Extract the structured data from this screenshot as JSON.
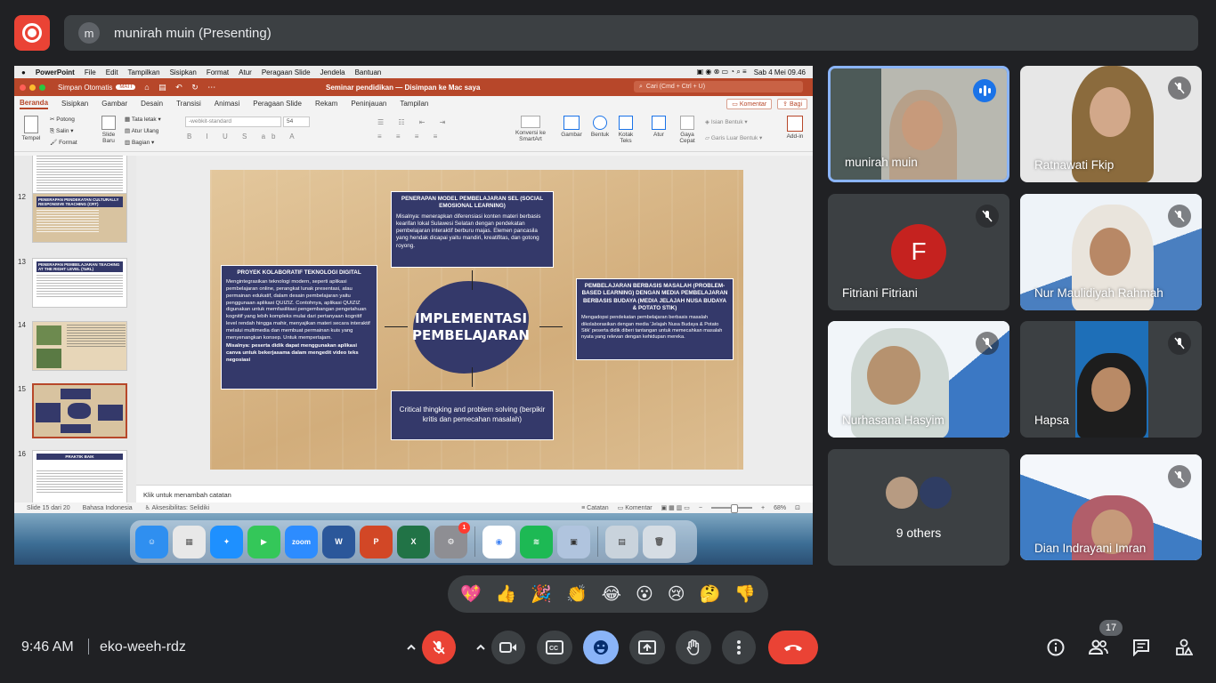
{
  "presenter_bar": {
    "avatar_initial": "m",
    "label": "munirah muin (Presenting)"
  },
  "mac_menu": {
    "items": [
      "PowerPoint",
      "File",
      "Edit",
      "Tampilkan",
      "Sisipkan",
      "Format",
      "Atur",
      "Peragaan Slide",
      "Jendela",
      "Bantuan"
    ],
    "datetime": "Sab 4 Mei  09.46"
  },
  "ppt_titlebar": {
    "autosave": "Simpan Otomatis",
    "autosave_state": "MATI",
    "doc_title": "Seminar pendidikan — Disimpan ke Mac saya",
    "search_placeholder": "Cari (Cmd + Ctrl + U)"
  },
  "ribbon_tabs": [
    "Beranda",
    "Sisipkan",
    "Gambar",
    "Desain",
    "Transisi",
    "Animasi",
    "Peragaan Slide",
    "Rekam",
    "Peninjauan",
    "Tampilan"
  ],
  "ribbon_actions": {
    "comment": "Komentar",
    "share": "Bagi"
  },
  "ribbon": {
    "paste": "Tempel",
    "cut": "Potong",
    "copy": "Salin",
    "format": "Format",
    "new_slide": "Slide Baru",
    "layout": "Tata letak",
    "reset": "Atur Ulang",
    "section": "Bagian",
    "font_name": "-webkit-standard",
    "font_size": "54",
    "convert_smartart": "Konversi ke SmartArt",
    "picture": "Gambar",
    "shape": "Bentuk",
    "textbox": "Kotak Teks",
    "arrange": "Atur",
    "quick_style": "Gaya Cepat",
    "shape_fill": "Isian Bentuk",
    "shape_outline": "Garis Luar Bentuk",
    "addins": "Add-in"
  },
  "thumbnails": [
    {
      "num": "12",
      "title": "PENERAPAN PENDEKATAN CULTURALLY RESPONSIVE TEACHING (CRT)"
    },
    {
      "num": "13",
      "title": "PENERAPAN PEMBELAJARAN TEACHING AT THE RIGHT LEVEL (TaRL)"
    },
    {
      "num": "14",
      "title": ""
    },
    {
      "num": "15",
      "title": ""
    },
    {
      "num": "16",
      "title": "PRAKTIK BAIK"
    }
  ],
  "slide": {
    "center": "IMPLEMENTASI PEMBELAJARAN",
    "top_title": "PENERAPAN MODEL PEMBELAJARAN SEL (SOCIAL EMOSIONAL LEARNING)",
    "top_body": "Misalnya: menerapkan diferensiasi konten materi berbasis kearifan lokal Sulawesi Selatan dengan pendekatan pembelajaran interaktif berburu majas. Elemen pancasila yang hendak dicapai yaitu mandiri, kreatifitas, dan gotong royong.",
    "left_title": "PROYEK KOLABORATIF TEKNOLOGI DIGITAL",
    "left_body": "Mengintegrasikan teknologi modern, seperti aplikasi pembelajaran online, perangkat lunak presentasi, atau permainan edukatif, dalam desain pembelajaran yaitu penggunaan aplikasi QUIZIZ. Contohnya, aplikasi QUIZIZ digunakan untuk memfasilitasi pengembangan pengetahuan kognitif yang lebih kompleks mulai dari pertanyaan kognitif level rendah hingga mahir, menyajikan materi secara interaktif melalui multimedia dan membuat permainan kuis yang menyenangkan konsep. Untuk mempertajam.",
    "left_example": "Misalnya: peserta didik dapat menggunakan aplikasi canva untuk bekerjasama dalam mengedit video teks negosiasi",
    "right_title": "PEMBELAJARAN BERBASIS MASALAH (PROBLEM-BASED LEARNING) DENGAN MEDIA PEMBELAJARAN BERBASIS BUDAYA (MEDIA JELAJAH NUSA BUDAYA & POTATO STIK)",
    "right_body": "Mengadopsi pendekatan pembelajaran berbasis masalah dikolaborasikan dengan media 'Jelajah Nusa Budaya & Potato Stik' peserta didik diberi tantangan untuk memecahkan masalah nyata yang relevan dengan kehidupan mereka.",
    "bottom_text": "Critical thingking and problem solving (berpikir kritis dan pemecahan masalah)"
  },
  "notes_placeholder": "Klik untuk menambah catatan",
  "statusbar": {
    "slide": "Slide 15 dari 20",
    "language": "Bahasa Indonesia",
    "accessibility": "Aksesibilitas: Selidiki",
    "notes": "Catatan",
    "comments": "Komentar",
    "zoom": "68%"
  },
  "dock_badge": "1",
  "participants": [
    {
      "name": "munirah muin"
    },
    {
      "name": "Ratnawati Fkip"
    },
    {
      "name": "Fitriani Fitriani",
      "initial": "F"
    },
    {
      "name": "Nur Maulidiyah Rahmah"
    },
    {
      "name": "Nurhasana Hasyim"
    },
    {
      "name": "Hapsa"
    },
    {
      "name": "9 others"
    },
    {
      "name": "Dian Indrayani Imran"
    }
  ],
  "reactions": [
    "💖",
    "👍",
    "🎉",
    "👏",
    "😂",
    "😮",
    "😢",
    "🤔",
    "👎"
  ],
  "bottom": {
    "time": "9:46 AM",
    "meeting_code": "eko-weeh-rdz",
    "participant_count": "17"
  },
  "colors": {
    "slide_box": "#34396a",
    "ppt_brand": "#b7472a",
    "leave_red": "#ea4335",
    "speaking_blue": "#8ab4f8"
  }
}
